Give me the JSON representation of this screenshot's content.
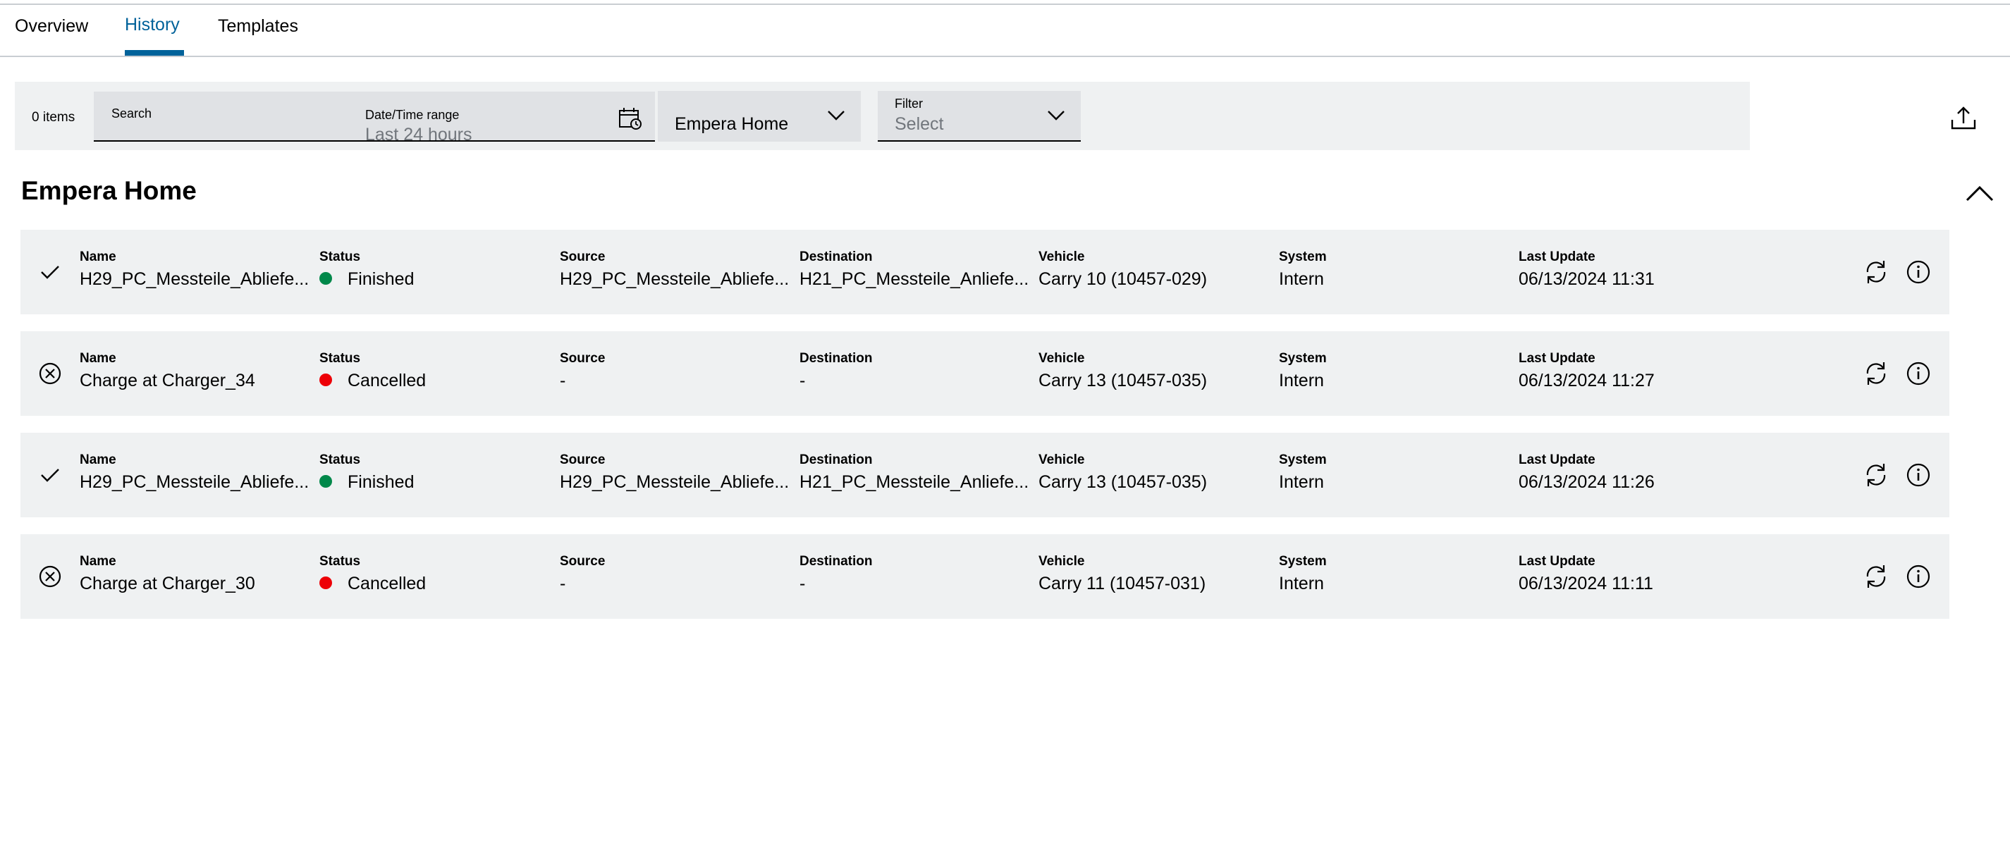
{
  "tabs": [
    {
      "label": "Overview"
    },
    {
      "label": "History"
    },
    {
      "label": "Templates"
    }
  ],
  "toolbar": {
    "items_count": "0 items",
    "search_label": "Search",
    "datetime_label": "Date/Time range",
    "datetime_value": "Last 24 hours",
    "site_value": "Empera Home",
    "filter_label": "Filter",
    "filter_placeholder": "Select"
  },
  "section": {
    "title": "Empera Home"
  },
  "columns": {
    "name": "Name",
    "status": "Status",
    "source": "Source",
    "destination": "Destination",
    "vehicle": "Vehicle",
    "system": "System",
    "last_update": "Last Update"
  },
  "colors": {
    "accent": "#00629a",
    "status_finished": "#00884a",
    "status_cancelled": "#ed0007"
  },
  "rows": [
    {
      "icon": "check-icon",
      "name": "H29_PC_Messteile_Abliefe...",
      "status": "Finished",
      "source": "H29_PC_Messteile_Abliefe...",
      "destination": "H21_PC_Messteile_Anliefe...",
      "vehicle": "Carry 10 (10457-029)",
      "system": "Intern",
      "last_update": "06/13/2024 11:31"
    },
    {
      "icon": "cancel-circle-icon",
      "name": "Charge at Charger_34",
      "status": "Cancelled",
      "source": "-",
      "destination": "-",
      "vehicle": "Carry 13 (10457-035)",
      "system": "Intern",
      "last_update": "06/13/2024 11:27"
    },
    {
      "icon": "check-icon",
      "name": "H29_PC_Messteile_Abliefe...",
      "status": "Finished",
      "source": "H29_PC_Messteile_Abliefe...",
      "destination": "H21_PC_Messteile_Anliefe...",
      "vehicle": "Carry 13 (10457-035)",
      "system": "Intern",
      "last_update": "06/13/2024 11:26"
    },
    {
      "icon": "cancel-circle-icon",
      "name": "Charge at Charger_30",
      "status": "Cancelled",
      "source": "-",
      "destination": "-",
      "vehicle": "Carry 11 (10457-031)",
      "system": "Intern",
      "last_update": "06/13/2024 11:11"
    }
  ]
}
